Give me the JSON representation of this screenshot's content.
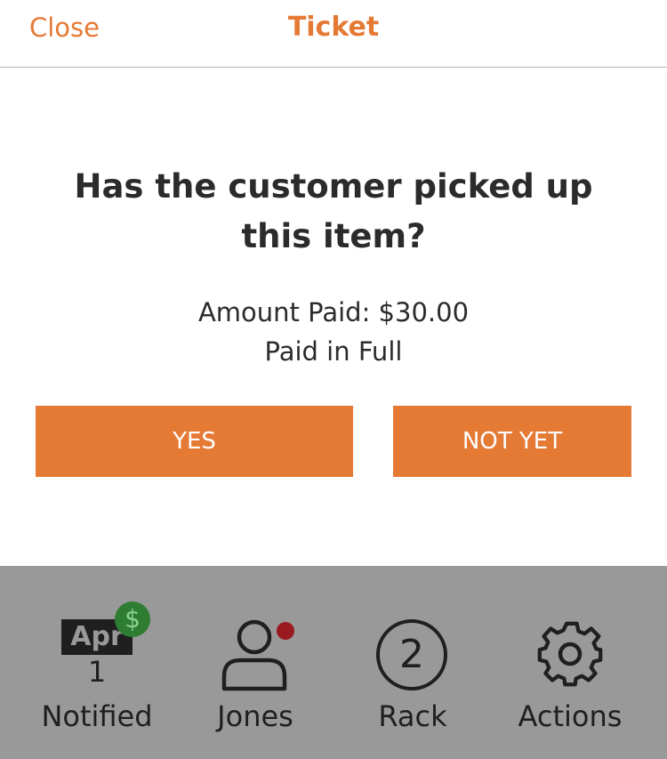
{
  "header": {
    "close_label": "Close",
    "title": "Ticket"
  },
  "prompt": {
    "question": "Has the customer picked up this item?",
    "amount_paid": "Amount Paid: $30.00",
    "paid_status": "Paid in Full"
  },
  "buttons": {
    "yes_label": "YES",
    "not_yet_label": "NOT YET"
  },
  "tabbar": {
    "notified": {
      "month": "Apr",
      "day": "1",
      "badge_symbol": "$",
      "label": "Notified"
    },
    "customer": {
      "icon": "person-icon",
      "label": "Jones"
    },
    "rack": {
      "number": "2",
      "label": "Rack"
    },
    "actions": {
      "icon": "gear-icon",
      "label": "Actions"
    }
  },
  "colors": {
    "accent": "#e57a35",
    "tabbar_bg": "#999999",
    "badge_green": "#2e7d32",
    "alert_dot": "#9b1a20"
  }
}
